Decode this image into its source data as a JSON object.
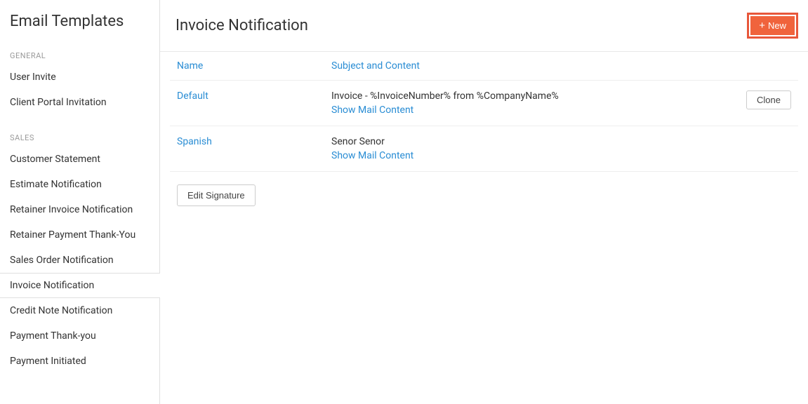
{
  "sidebar": {
    "title": "Email Templates",
    "sections": [
      {
        "label": "GENERAL",
        "items": [
          {
            "label": "User Invite",
            "active": false
          },
          {
            "label": "Client Portal Invitation",
            "active": false
          }
        ]
      },
      {
        "label": "SALES",
        "items": [
          {
            "label": "Customer Statement",
            "active": false
          },
          {
            "label": "Estimate Notification",
            "active": false
          },
          {
            "label": "Retainer Invoice Notification",
            "active": false
          },
          {
            "label": "Retainer Payment Thank-You",
            "active": false
          },
          {
            "label": "Sales Order Notification",
            "active": false
          },
          {
            "label": "Invoice Notification",
            "active": true
          },
          {
            "label": "Credit Note Notification",
            "active": false
          },
          {
            "label": "Payment Thank-you",
            "active": false
          },
          {
            "label": "Payment Initiated",
            "active": false
          }
        ]
      }
    ]
  },
  "main": {
    "title": "Invoice Notification",
    "new_button_label": "New",
    "columns": {
      "name": "Name",
      "subject": "Subject and Content"
    },
    "rows": [
      {
        "name": "Default",
        "subject": "Invoice - %InvoiceNumber% from %CompanyName%",
        "show_link": "Show Mail Content",
        "action": "Clone"
      },
      {
        "name": "Spanish",
        "subject": "Senor Senor",
        "show_link": "Show Mail Content",
        "action": ""
      }
    ],
    "edit_signature_label": "Edit Signature"
  }
}
